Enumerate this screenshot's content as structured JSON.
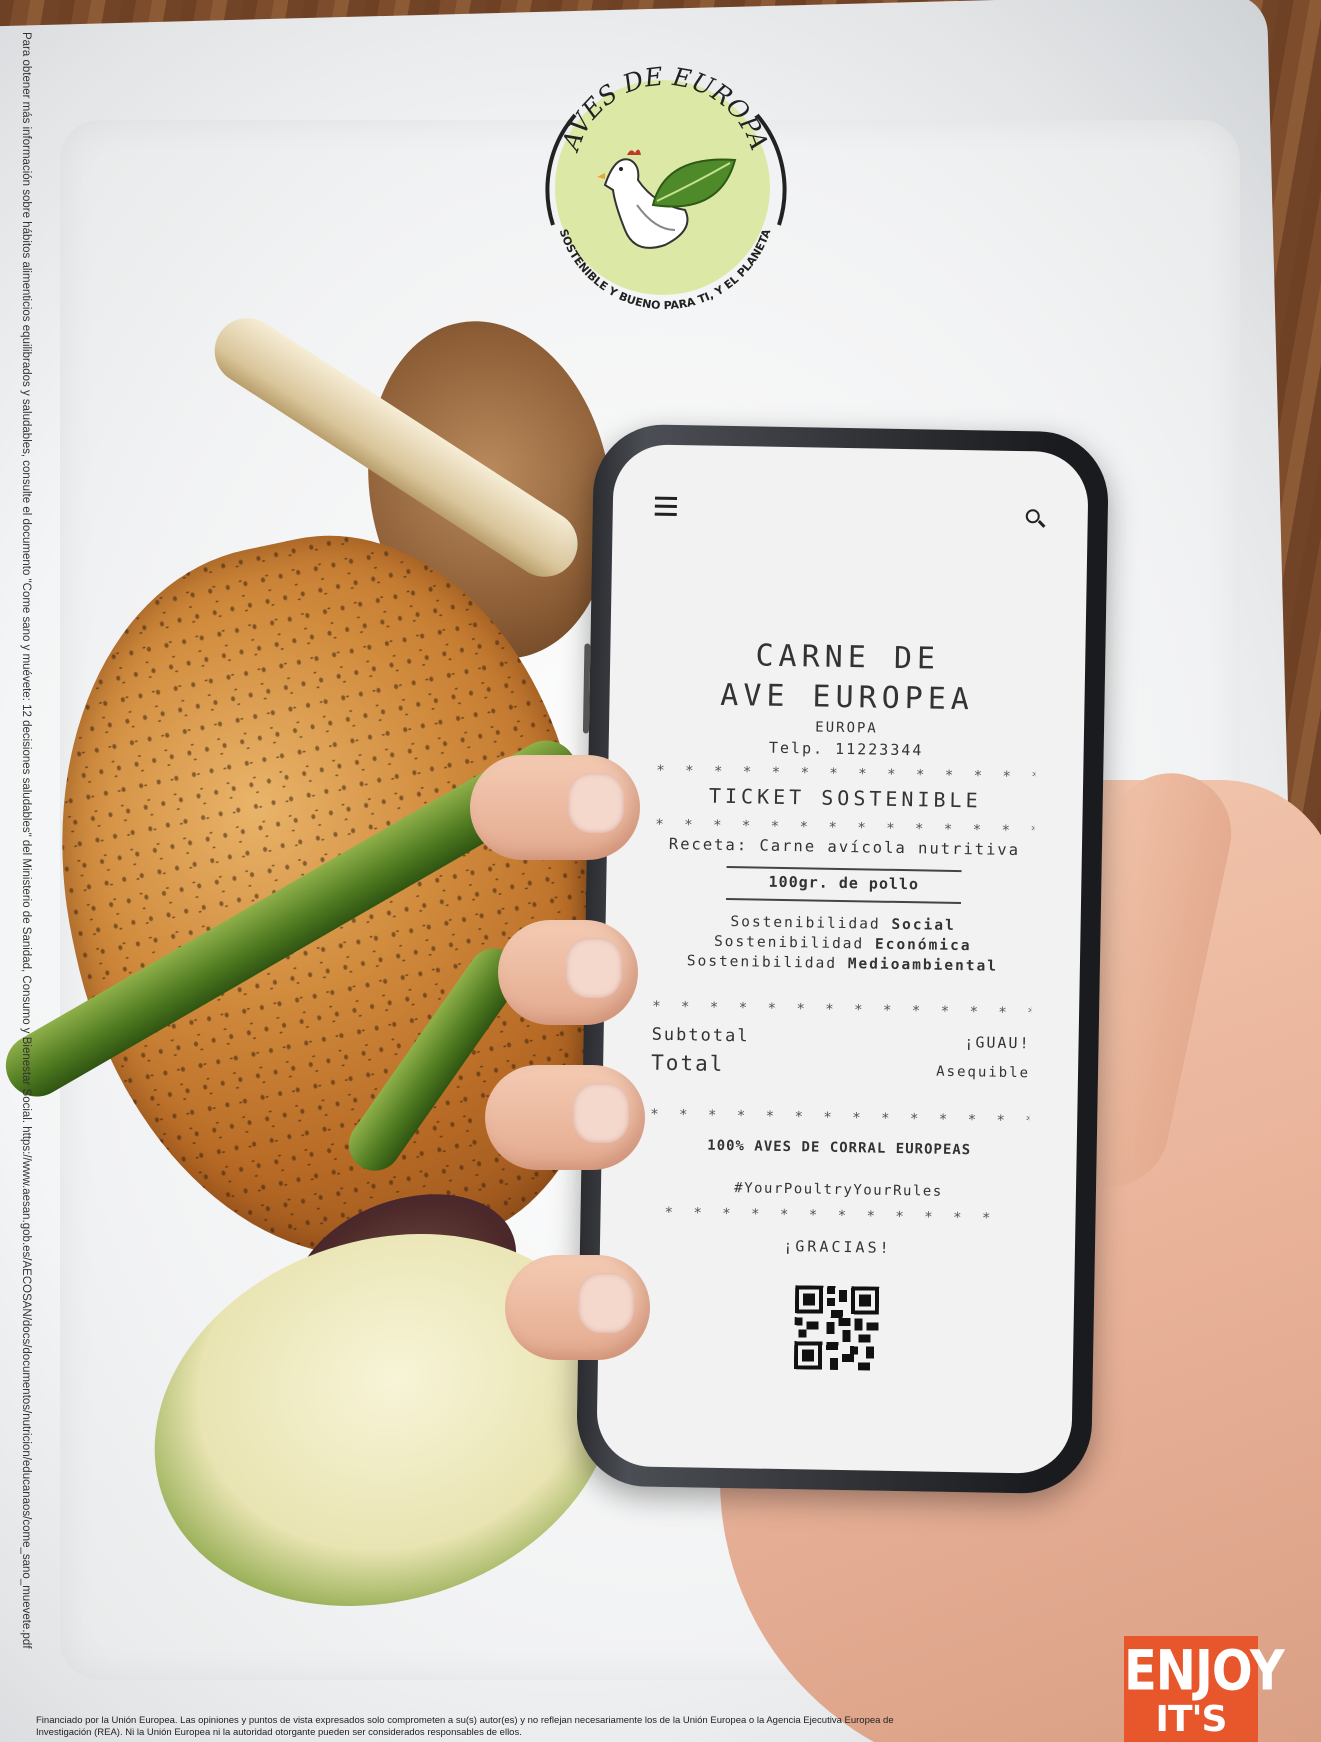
{
  "brand": {
    "arc_top": "AVES DE EUROPA",
    "arc_bottom": "SOSTENIBLE Y BUENO PARA TI, Y EL PLANETA"
  },
  "side_note": "Para obtener más información sobre hábitos alimenticios equilibrados y saludables, consulte el documento \"Come sano y muévete: 12 decisiones saludables\" del Ministerio de Sanidad, Consumo y Bienestar Social. https://www.aesan.gob.es/AECOSAN/docs/documentos/nutricion/educanaos/come_sano_muevete.pdf",
  "receipt": {
    "title_line1": "CARNE DE",
    "title_line2": "AVE EUROPEA",
    "subtitle": "EUROPA",
    "phone": "Telp. 11223344",
    "stars": "* * * * * * * * * * * * * * * * * * * * * * *",
    "ticket_label": "TICKET SOSTENIBLE",
    "recipe": "Receta: Carne avícola nutritiva",
    "portion": "100gr. de pollo",
    "sustainability": [
      {
        "prefix": "Sostenibilidad",
        "bold": "Social"
      },
      {
        "prefix": "Sostenibilidad",
        "bold": "Económica"
      },
      {
        "prefix": "Sostenibilidad",
        "bold": "Medioambiental"
      }
    ],
    "subtotal_label": "Subtotal",
    "subtotal_value": "¡GUAU!",
    "total_label": "Total",
    "total_value": "Asequible",
    "origin": "100% AVES DE CORRAL EUROPEAS",
    "hashtag": "#YourPoultryYourRules",
    "thanks": "¡GRACIAS!"
  },
  "footer": {
    "line1": "Financiado por la Unión Europea. Las opiniones y puntos de vista expresados solo comprometen a su(s) autor(es) y no reflejan necesariamente los de la Unión Europea o la Agencia Ejecutiva Europea de",
    "line2": "Investigación (REA). Ni la Unión Europea ni la autoridad otorgante pueden ser considerados responsables de ellos."
  },
  "badge": {
    "line1": "ENJOY",
    "line2": "IT'S FROM"
  },
  "colors": {
    "logo_green": "#dce9a6",
    "badge_orange": "#e8562b"
  }
}
